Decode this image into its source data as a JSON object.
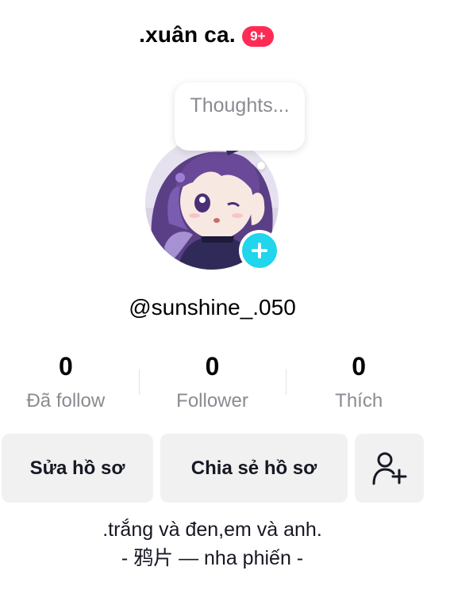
{
  "header": {
    "display_name": ".xuân ca.",
    "notification_badge": "9+"
  },
  "thought_bubble": {
    "text": "Thoughts..."
  },
  "profile": {
    "username": "@sunshine_.050",
    "add_icon": "plus-icon"
  },
  "stats": [
    {
      "value": "0",
      "label": "Đã follow"
    },
    {
      "value": "0",
      "label": "Follower"
    },
    {
      "value": "0",
      "label": "Thích"
    }
  ],
  "actions": {
    "edit_profile": "Sửa hồ sơ",
    "share_profile": "Chia sẻ hồ sơ",
    "add_friend_icon": "person-add-icon"
  },
  "bio": {
    "line1": ".trắng và đen,em và anh.",
    "line2": "- 鸦片 — nha phiến -"
  },
  "colors": {
    "badge": "#fe2c55",
    "add_button": "#20d5ec",
    "button_bg": "#f1f1f2",
    "muted_text": "#8a8b91"
  }
}
